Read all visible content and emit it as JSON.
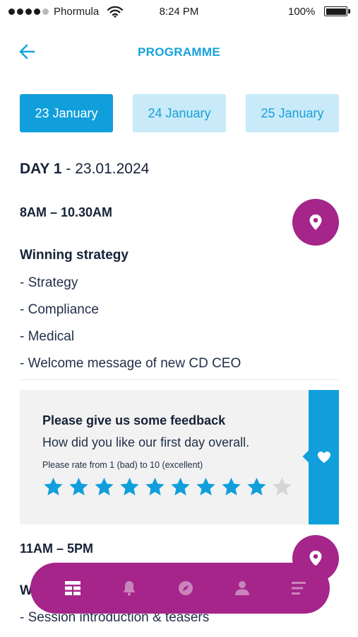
{
  "status_bar": {
    "carrier": "Phormula",
    "time": "8:24 PM",
    "battery": "100%"
  },
  "header": {
    "title": "PROGRAMME",
    "back_icon": "arrow-left-icon"
  },
  "tabs": [
    {
      "label": "23 January",
      "active": true
    },
    {
      "label": "24 January",
      "active": false
    },
    {
      "label": "25 January",
      "active": false
    }
  ],
  "day": {
    "label": "DAY 1",
    "date": " - 23.01.2024"
  },
  "sessions": [
    {
      "time": "8AM – 10.30AM",
      "title": "Winning strategy",
      "items": [
        "- Strategy",
        "- Compliance",
        "- Medical",
        "- Welcome message of new CD CEO"
      ]
    },
    {
      "time": "11AM – 5PM",
      "title": "W",
      "items": [
        "- Session introduction & teasers"
      ]
    }
  ],
  "feedback": {
    "title": "Please give us some feedback",
    "subtitle": "How did you like our first day overall.",
    "hint": "Please rate from 1 (bad) to 10 (excellent)",
    "rating": 9,
    "max_rating": 10,
    "side_icon": "heart-icon"
  },
  "bottom_nav": [
    {
      "icon": "programme-grid-icon",
      "active": true
    },
    {
      "icon": "bell-icon",
      "active": false
    },
    {
      "icon": "compass-icon",
      "active": false
    },
    {
      "icon": "user-icon",
      "active": false
    },
    {
      "icon": "menu-icon",
      "active": false
    }
  ],
  "colors": {
    "accent": "#119fdc",
    "tab_inactive": "#c8eaf9",
    "brand_purple": "#a5258a",
    "text": "#152238",
    "star_empty": "#d6d6d6"
  }
}
